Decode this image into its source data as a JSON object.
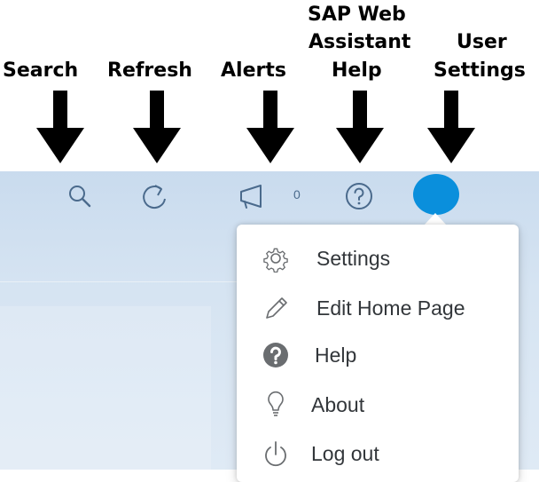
{
  "annotations": {
    "search": "Search",
    "refresh": "Refresh",
    "alerts": "Alerts",
    "assistant_line1": "SAP Web",
    "assistant_line2": "Assistant",
    "assistant_line3": "Help",
    "user_line1": "User",
    "user_line2": "Settings"
  },
  "toolbar": {
    "search_icon": "search-icon",
    "refresh_icon": "refresh-icon",
    "alerts_icon": "megaphone-icon",
    "alerts_count": "0",
    "help_icon": "question-circle-icon",
    "avatar_color": "#0a8fdc"
  },
  "user_menu": {
    "items": [
      {
        "label": "Settings",
        "icon": "gear-icon"
      },
      {
        "label": "Edit Home Page",
        "icon": "pencil-icon"
      },
      {
        "label": "Help",
        "icon": "question-filled-icon"
      },
      {
        "label": "About",
        "icon": "lightbulb-icon"
      },
      {
        "label": "Log out",
        "icon": "power-icon"
      }
    ]
  },
  "colors": {
    "accent": "#0a8fdc",
    "icon": "#4a6a8c",
    "menu_text": "#32363a",
    "menu_icon": "#6a6d70"
  }
}
